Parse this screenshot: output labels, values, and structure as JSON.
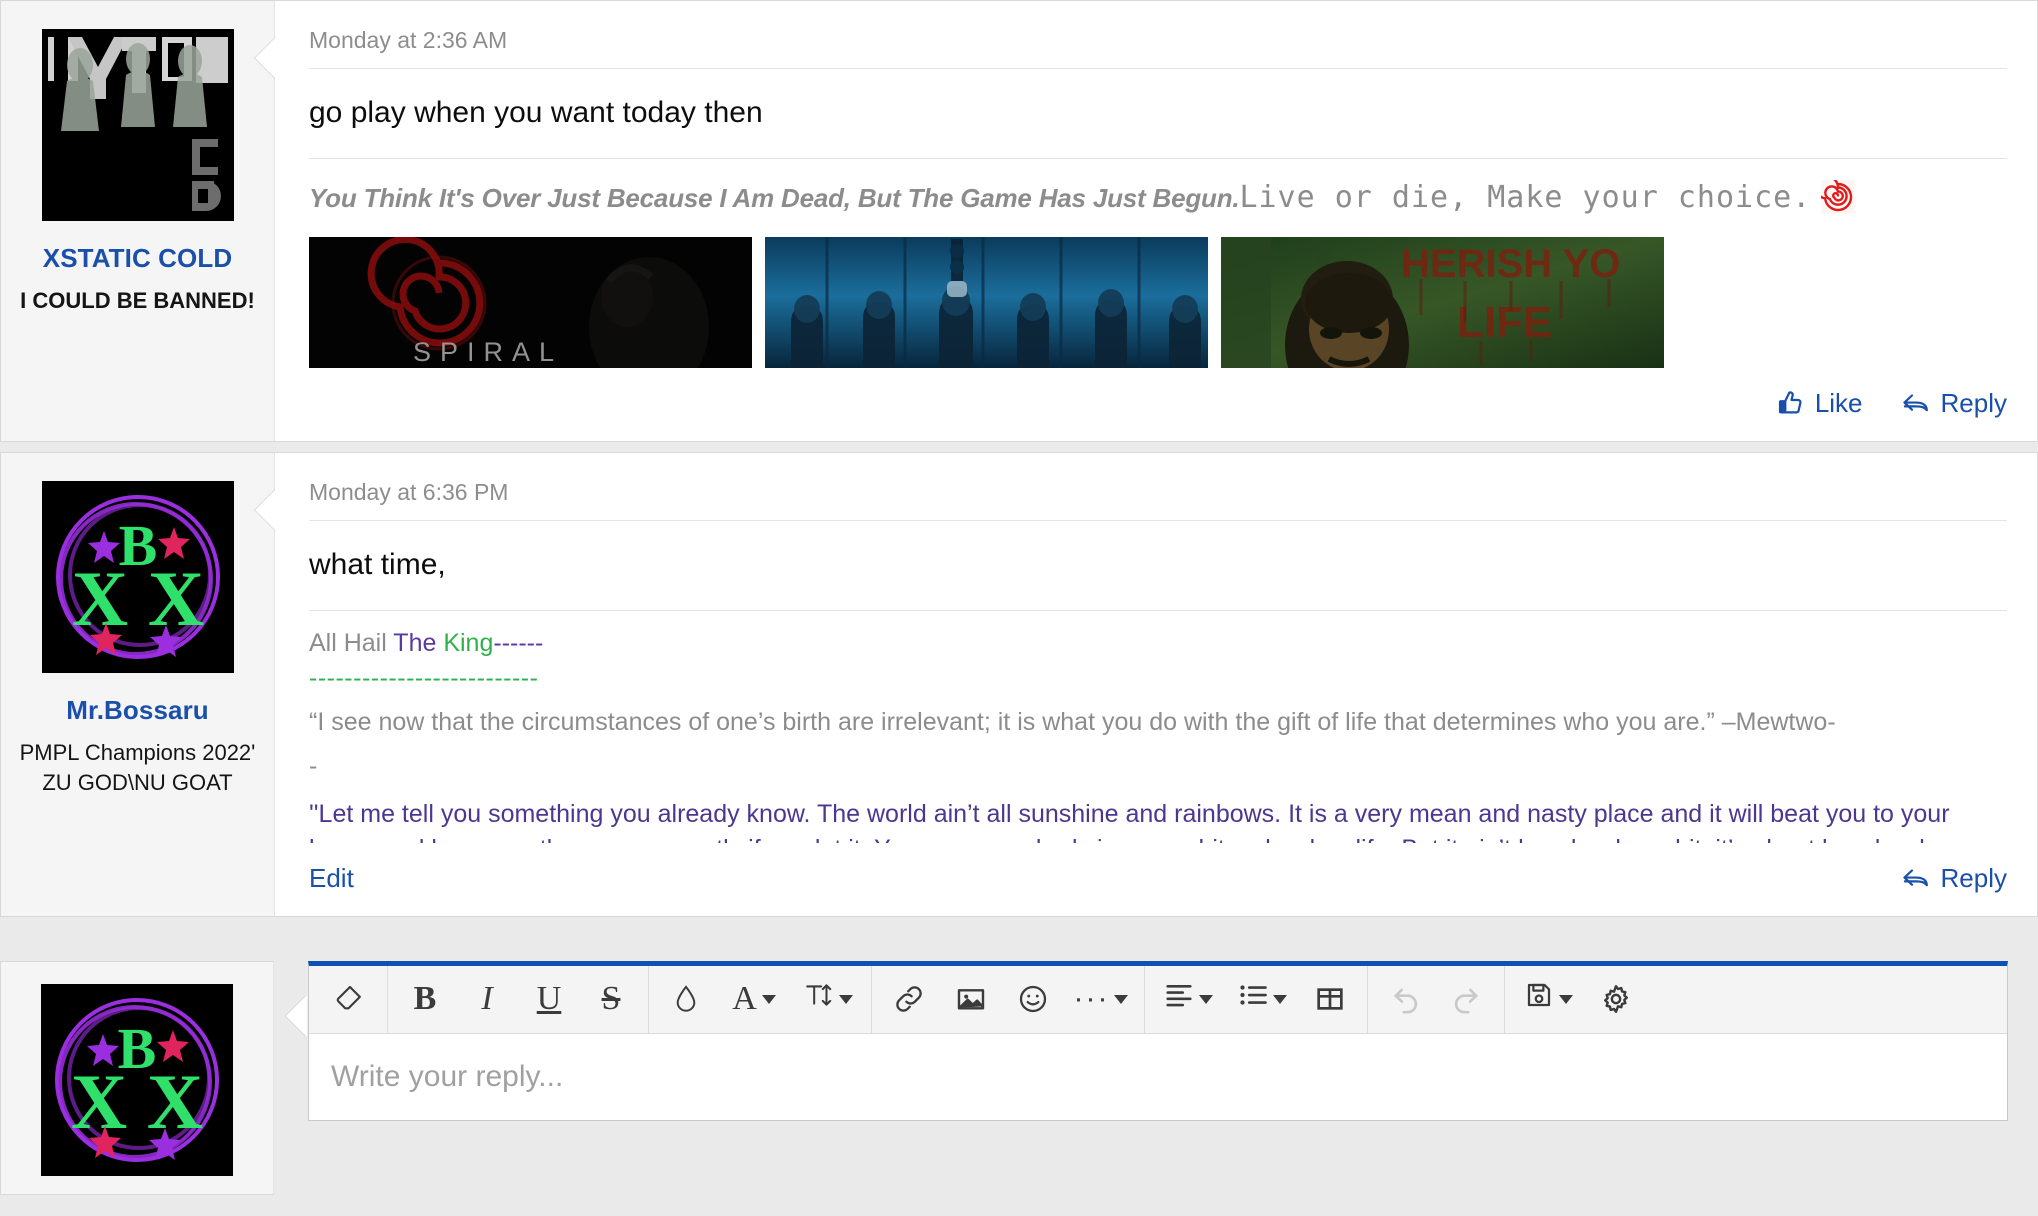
{
  "posts": [
    {
      "user": {
        "name": "XSTATIC COLD",
        "title": "I COULD BE BANNED!",
        "avatar_alt": "xstatic-cold-avatar"
      },
      "timestamp": "Monday at 2:36 AM",
      "message": "go play when you want today then",
      "signature": {
        "italic_part": "You Think It's Over Just Because I Am Dead, But The Game Has Just Begun.",
        "mono_part": "Live or die, Make your choice.",
        "emoji": "spiral-icon",
        "images": [
          "spiral-movie-poster",
          "saw-pig-mask-scene",
          "cherish-your-life-wall"
        ]
      },
      "actions": {
        "like": "Like",
        "reply": "Reply"
      }
    },
    {
      "user": {
        "name": "Mr.Bossaru",
        "title": "PMPL Champions 2022' ZU GOD\\NU GOAT",
        "avatar_alt": "mr-bossaru-avatar"
      },
      "timestamp": "Monday at 6:36 PM",
      "message": "what time,",
      "signature": {
        "hail_plain": "All Hail ",
        "hail_the": "The ",
        "hail_king": "King",
        "hail_dashes_purple": "------",
        "hail_dashes_green": "--------------------------",
        "mewtwo_quote": "“I see now that the circumstances of one’s birth are irrelevant; it is what you do with the gift of life that determines who you are.” –Mewtwo-",
        "mewtwo_trailing": "-",
        "rocky_quote": "''Let me tell you something you already know. The world ain’t all sunshine and rainbows. It is a very mean and nasty place and it will beat you to your knees and keep you there permanently if you let it. You, me, or nobody is gonna hit as hard as life. But it ain’t how hard you hit; it’s about how hard you can get hit, and keep moving forward. How much you can take, and keep moving forward. That’s how winning is done. Now, if you know what you’re worth, then go out and get what you’re worth. But you gotta be willing to take the hit, and not pointing fingers"
      },
      "actions": {
        "edit": "Edit",
        "reply": "Reply"
      }
    }
  ],
  "editor": {
    "placeholder": "Write your reply...",
    "toolbar_groups": [
      {
        "buttons": [
          {
            "name": "remove-formatting-icon",
            "label": ""
          }
        ]
      },
      {
        "buttons": [
          {
            "name": "bold-button",
            "label": "B"
          },
          {
            "name": "italic-button",
            "label": "I"
          },
          {
            "name": "underline-button",
            "label": "U"
          },
          {
            "name": "strikethrough-button",
            "label": "S"
          }
        ]
      },
      {
        "buttons": [
          {
            "name": "text-color-button",
            "label": ""
          },
          {
            "name": "font-family-button",
            "label": "A"
          },
          {
            "name": "font-size-button",
            "label": "T"
          }
        ]
      },
      {
        "buttons": [
          {
            "name": "insert-link-button",
            "label": ""
          },
          {
            "name": "insert-image-button",
            "label": ""
          },
          {
            "name": "insert-smilie-button",
            "label": ""
          },
          {
            "name": "more-options-button",
            "label": "···"
          }
        ]
      },
      {
        "buttons": [
          {
            "name": "text-align-button",
            "label": ""
          },
          {
            "name": "list-button",
            "label": ""
          },
          {
            "name": "insert-table-button",
            "label": ""
          }
        ]
      },
      {
        "buttons": [
          {
            "name": "undo-button",
            "label": ""
          },
          {
            "name": "redo-button",
            "label": ""
          }
        ]
      },
      {
        "buttons": [
          {
            "name": "draft-button",
            "label": ""
          },
          {
            "name": "editor-settings-button",
            "label": ""
          }
        ]
      }
    ]
  },
  "colors": {
    "link": "#1a4faa",
    "editor_accent": "#0d51b3",
    "signature_gray": "#8c8c8c",
    "signature_purple": "#4b3791",
    "signature_green": "#2fb24c",
    "page_background": "#eaeaea"
  }
}
